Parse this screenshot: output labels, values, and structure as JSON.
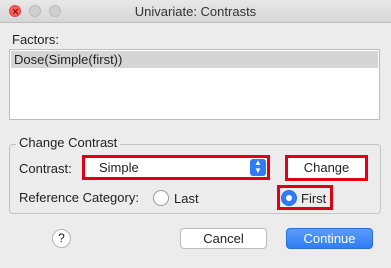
{
  "window": {
    "title": "Univariate: Contrasts"
  },
  "factors": {
    "label": "Factors:",
    "items": [
      "Dose(Simple(first))"
    ]
  },
  "change_contrast": {
    "group_label": "Change Contrast",
    "contrast_label": "Contrast:",
    "contrast_value": "Simple",
    "change_button": "Change",
    "reference_label": "Reference Category:",
    "options": [
      {
        "label": "Last",
        "selected": false
      },
      {
        "label": "First",
        "selected": true
      }
    ]
  },
  "buttons": {
    "help": "?",
    "cancel": "Cancel",
    "continue": "Continue"
  },
  "colors": {
    "accent": "#2f7cf6",
    "highlight": "#e00012"
  }
}
